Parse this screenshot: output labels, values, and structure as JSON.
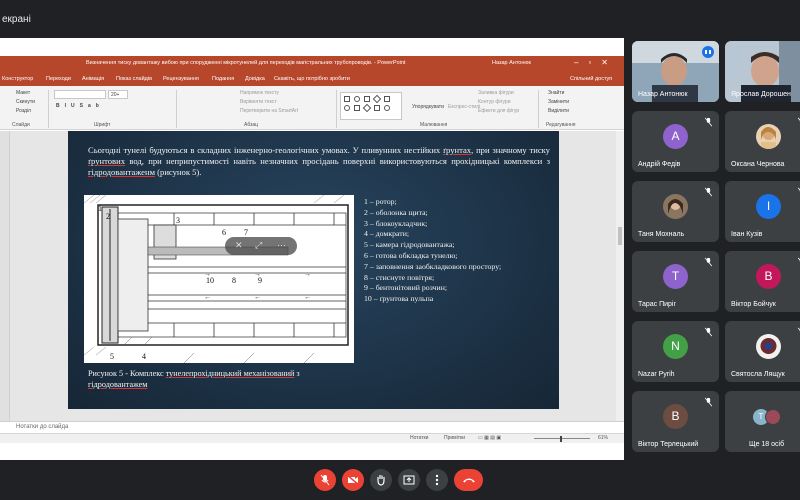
{
  "meet": {
    "top_title": "екрані"
  },
  "powerpoint": {
    "doc_title": "Визначення тиску довантажу вибою при спорудженні мікротунелей для переходів магістральних трубопроводів. - PowerPoint",
    "user_name": "Назар Антонюк",
    "tabs": [
      "Конструктор",
      "Переходи",
      "Анімація",
      "Показ слайдів",
      "Рецензування",
      "Подання",
      "Довідка",
      "Скажіть, що потрібно зробити"
    ],
    "share_label": "Спільний доступ",
    "ribbon": {
      "layout_label": "Макет",
      "reset_label": "Скинути",
      "section_label": "Розділ",
      "slides_group": "Слайди",
      "font_group": "Шрифт",
      "paragraph_group": "Абзац",
      "drawing_group": "Малювання",
      "editing_group": "Редагування",
      "text_direction": "Напрямок тексту",
      "align_text": "Вирівняти текст",
      "convert_smartart": "Перетворити на SmartArt",
      "arrange_label": "Упорядкувати",
      "quick_styles": "Експрес-стилі",
      "shape_fill": "Заливка фігури",
      "shape_outline": "Контур фігури",
      "shape_effects": "Ефекти для фігур",
      "find_label": "Знайти",
      "replace_label": "Замінити",
      "select_label": "Виділити",
      "font_size": "20+"
    },
    "slide": {
      "paragraph_parts": [
        "Сьогодні тунелі будуються в складних інженерно-геологічних умовах. У пливунних нестійких ",
        "ґрунтах",
        ", при значному тиску ",
        "ґрунтових",
        " вод, при неприпустимості навіть незначних просідань поверхні використовуються прохідницькі комплекси з ",
        "гідродовантаженм",
        " (рисунок 5)."
      ],
      "legend": [
        "1 – ротор;",
        "2 – оболонка щита;",
        "3 – блокоукладчик;",
        "4 – домкрати;",
        "5 – камера гідродовантажа;",
        "6 – готова обкладка тунелю;",
        "7 – заповнення заобкладкового простору;",
        "8 – стиснуте повітря;",
        "9 – бентонітовий розчин;",
        "10 – ґрунтова пульпа"
      ],
      "caption_prefix": "Рисунок 5 - Комплекс ",
      "caption_u1": "тунелепрохідницький механізований",
      "caption_mid": " з ",
      "caption_u2": "гідродовантажем",
      "figure_numbers": [
        "1",
        "2",
        "3",
        "4",
        "5",
        "6",
        "7",
        "8",
        "9",
        "10"
      ]
    },
    "notes_placeholder": "Нотатки до слайда",
    "status": {
      "notes": "Нотатки",
      "comments": "Примітки",
      "zoom": "61%"
    }
  },
  "participants": [
    {
      "name": "Назар Антонюк",
      "kind": "video",
      "speaking": true
    },
    {
      "name": "Ярослав Дорошен",
      "kind": "video"
    },
    {
      "name": "Андрій Федів",
      "kind": "avatar",
      "initial": "A",
      "color": "#8e63ce"
    },
    {
      "name": "Оксана Чернова",
      "kind": "photo",
      "color": "#d8a878"
    },
    {
      "name": "Таня Мохналь",
      "kind": "photo",
      "color": "#6b5a4a"
    },
    {
      "name": "Іван Кузів",
      "kind": "avatar",
      "initial": "I",
      "color": "#1a73e8"
    },
    {
      "name": "Тарас Пиріг",
      "kind": "avatar",
      "initial": "T",
      "color": "#8e63ce"
    },
    {
      "name": "Віктор Бойчук",
      "kind": "avatar",
      "initial": "B",
      "color": "#c2185b"
    },
    {
      "name": "Nazar Pyrih",
      "kind": "avatar",
      "initial": "N",
      "color": "#43a047"
    },
    {
      "name": "Святосла Лящук",
      "kind": "photo",
      "color": "#5a3f3f"
    },
    {
      "name": "Віктор Терлецький",
      "kind": "avatar",
      "initial": "B",
      "color": "#6d4c41"
    },
    {
      "name": "Ще 18 осіб",
      "kind": "more"
    }
  ]
}
